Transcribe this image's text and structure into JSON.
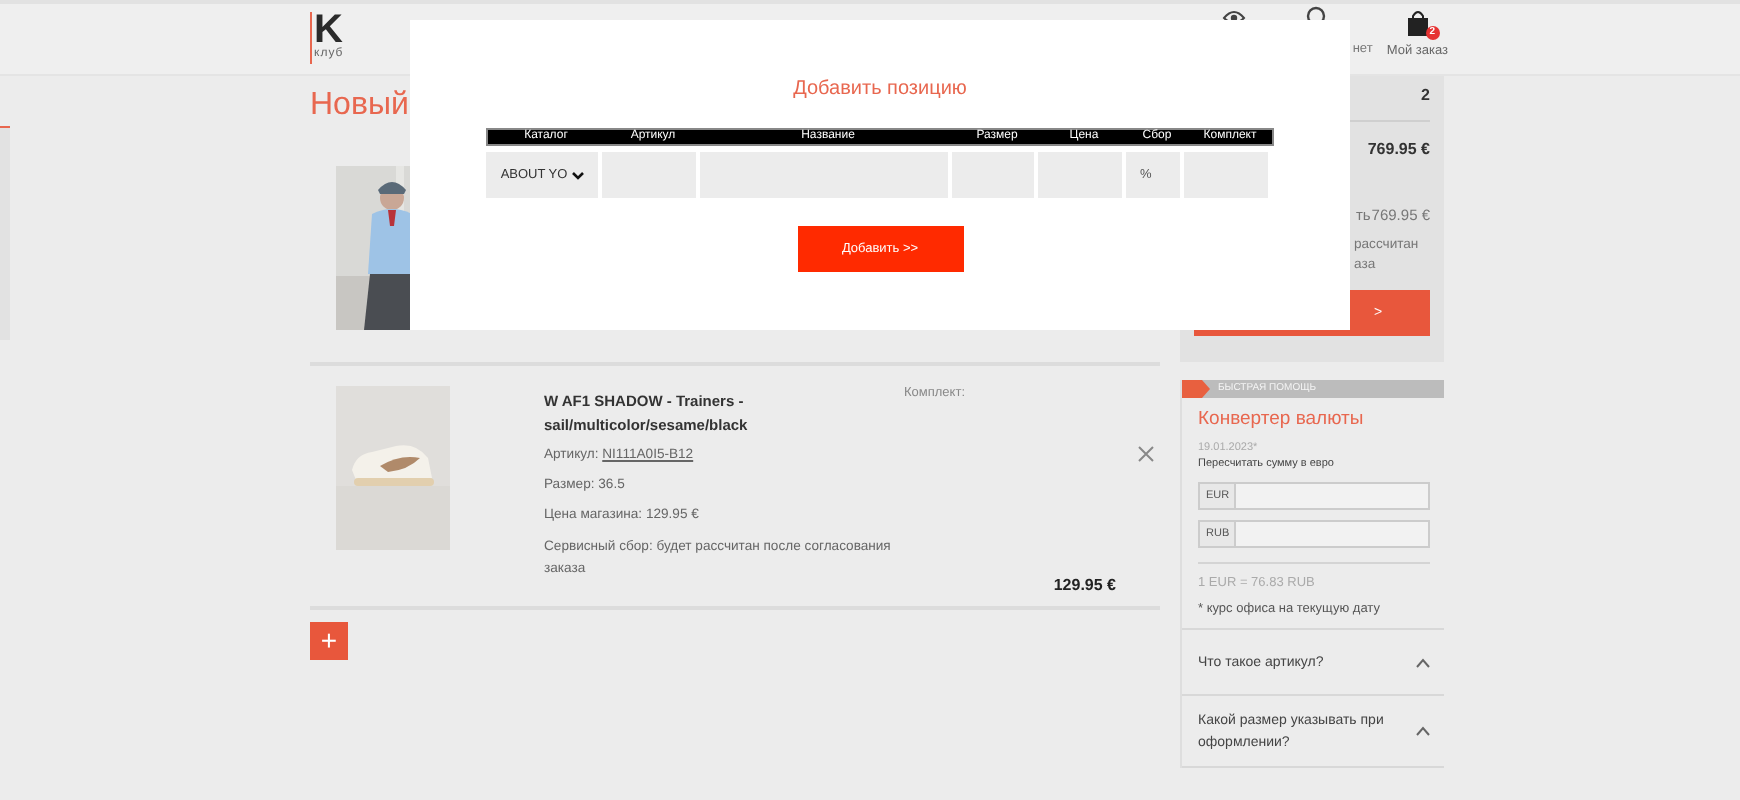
{
  "header": {
    "logo": "K",
    "logo_caption": "клуб",
    "account_label": "нет",
    "cart_label": "Мой заказ",
    "cart_badge": "2"
  },
  "page_title": "Новый",
  "items": [
    {
      "kind": "covered"
    },
    {
      "kind": "full",
      "title": "W AF1 SHADOW - Trainers - sail/multicolor/sesame/black",
      "article_label": "Артикул:",
      "article": "NI111A0I5-B12",
      "size": "Размер: 36.5",
      "store_price": "Цена магазина: 129.95 €",
      "fee": "Сервисный сбор: будет рассчитан после согласования заказа",
      "set_label": "Комплект:",
      "total": "129.95 €"
    }
  ],
  "add_button": "+",
  "order_summary": {
    "count": "2",
    "total": "769.95 €",
    "due_fragment": "ть",
    "due": "769.95 €",
    "note_lines": [
      "рассчитан",
      "аза"
    ],
    "button": ">"
  },
  "help": {
    "header": "БЫСТРАЯ ПОМОЩЬ",
    "converter_title": "Конвертер валюты",
    "date": "19.01.2023*",
    "hint": "Пересчитать сумму в евро",
    "fields": [
      {
        "currency": "EUR"
      },
      {
        "currency": "RUB"
      }
    ],
    "rate": "1 EUR = 76.83 RUB",
    "footnote": "* курс офиса на текущую дату",
    "faq": [
      {
        "question": "Что такое артикул?"
      },
      {
        "question": "Какой размер указывать при оформлении?"
      }
    ]
  },
  "dialog": {
    "title": "Добавить позицию",
    "columns": [
      "Каталог",
      "Артикул",
      "Название",
      "Размер",
      "Цена",
      "Сбор",
      "Комплект"
    ],
    "cells": [
      {
        "kind": "select",
        "value": "ABOUT YO"
      },
      {
        "kind": "input"
      },
      {
        "kind": "input"
      },
      {
        "kind": "input"
      },
      {
        "kind": "input"
      },
      {
        "kind": "unit",
        "unit": "%"
      },
      {
        "kind": "input"
      }
    ],
    "button": "Добавить >>"
  }
}
